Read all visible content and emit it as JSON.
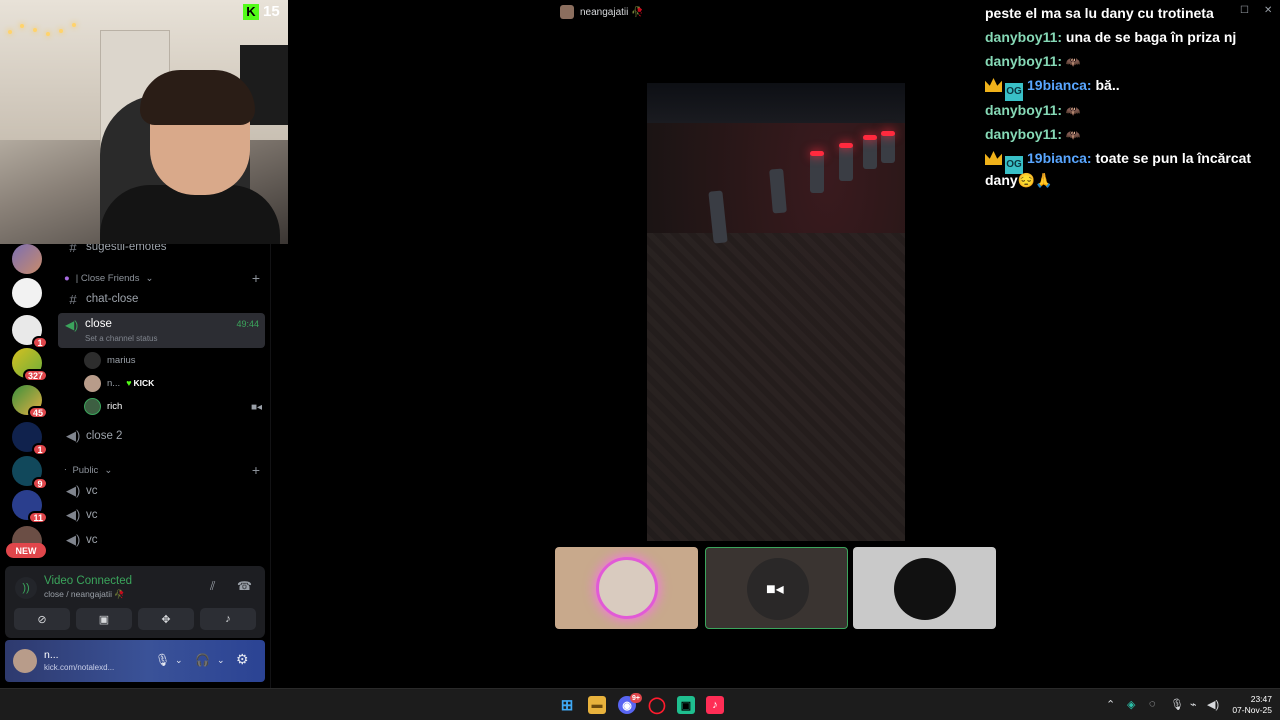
{
  "window": {
    "title": "neangajatii 🥀",
    "controls": [
      "—",
      "☐",
      "✕"
    ]
  },
  "webcam": {
    "platform_logo": "K",
    "viewer_count": "15"
  },
  "servers": [
    {
      "badge": ""
    },
    {
      "badge": ""
    },
    {
      "badge": "1"
    },
    {
      "badge": "327"
    },
    {
      "badge": "45"
    },
    {
      "badge": "1"
    },
    {
      "badge": "9"
    },
    {
      "badge": "11"
    },
    {
      "badge": ""
    }
  ],
  "server_new_label": "NEW",
  "channels": {
    "partial_channel": "sugestii-emotes",
    "close_friends_category": "| Close Friends",
    "chat_close": "chat-close",
    "active_voice": {
      "name": "close",
      "status": "Set a channel status",
      "timer": "49:44"
    },
    "members": [
      {
        "name": "marius"
      },
      {
        "name": "n...",
        "badge": "KICK"
      },
      {
        "name": "rich"
      }
    ],
    "close_2": "close 2",
    "public_category": "Public",
    "public_voice": [
      "vc",
      "vc",
      "vc"
    ]
  },
  "voice_panel": {
    "title": "Video Connected",
    "subtitle": "close / neangajatii 🥀",
    "buttons": [
      "camera-off",
      "screen-share",
      "activities",
      "soundboard"
    ]
  },
  "user_panel": {
    "name": "n...",
    "status": "kick.com/notalexd..."
  },
  "chat": {
    "messages": [
      {
        "user": "",
        "text": "peste el ma sa lu dany cu trotineta",
        "color": "#ffffff"
      },
      {
        "user": "danyboy11:",
        "text": "una de se baga în priza nj",
        "color": "#86d9b6"
      },
      {
        "user": "danyboy11:",
        "text": "",
        "emote": "🦇",
        "color": "#86d9b6"
      },
      {
        "user": "19bianca:",
        "text": "bă..",
        "color": "#59a6ff",
        "badges": true
      },
      {
        "user": "danyboy11:",
        "text": "",
        "emote": "🦇",
        "color": "#86d9b6"
      },
      {
        "user": "danyboy11:",
        "text": "",
        "emote": "🦇",
        "color": "#86d9b6"
      },
      {
        "user": "19bianca:",
        "text": "toate se pun la încărcat",
        "color": "#59a6ff",
        "badges": true
      },
      {
        "user": "",
        "text": "dany😔🙏",
        "color": "#ffffff"
      }
    ]
  },
  "taskbar": {
    "time": "23:47",
    "date": "07-Nov-25",
    "discord_badge": "9+"
  },
  "colors": {
    "accent_green": "#3ba55c",
    "kick_green": "#53fc18",
    "badge_red": "#e0464b"
  }
}
